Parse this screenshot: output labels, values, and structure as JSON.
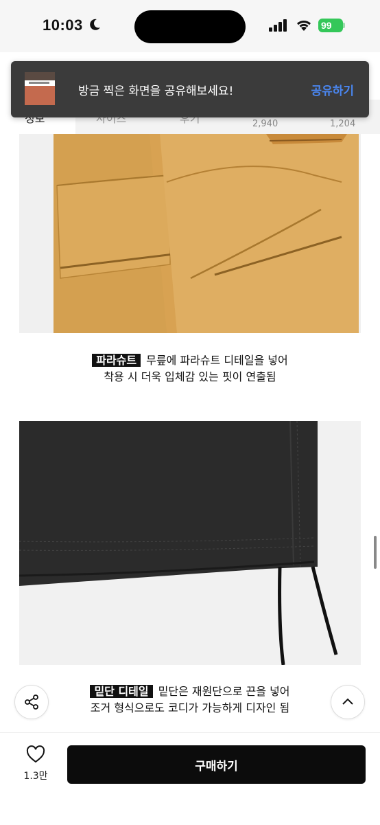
{
  "status_bar": {
    "time": "10:03",
    "battery": "99"
  },
  "toast": {
    "message": "방금 찍은 화면을 공유해보세요!",
    "action": "공유하기"
  },
  "tabs": {
    "items": [
      "정보",
      "사이즈",
      "후기"
    ],
    "counts": [
      "2,940",
      "1,204"
    ]
  },
  "details": [
    {
      "tag": "파라슈트",
      "line1": "무릎에 파라슈트 디테일을 넣어",
      "line2": "착용 시 더욱 입체감 있는 핏이 연출됨",
      "image_color": "#d9a457"
    },
    {
      "tag": "밑단 디테일",
      "line1": "밑단은 재원단으로 끈을 넣어",
      "line2": "조거 형식으로도 코디가 가능하게 디자인 됨",
      "image_color": "#2a2a2a"
    }
  ],
  "bottom_bar": {
    "like_count": "1.3만",
    "buy_label": "구매하기"
  },
  "icons": [
    "moon-icon",
    "signal-icon",
    "wifi-icon",
    "share-icon",
    "chevron-up-icon",
    "heart-icon"
  ],
  "colors": {
    "toast_bg": "#3b3b3b",
    "toast_action": "#4a86f0",
    "battery": "#34c759",
    "buy_button": "#0c0c0c"
  }
}
